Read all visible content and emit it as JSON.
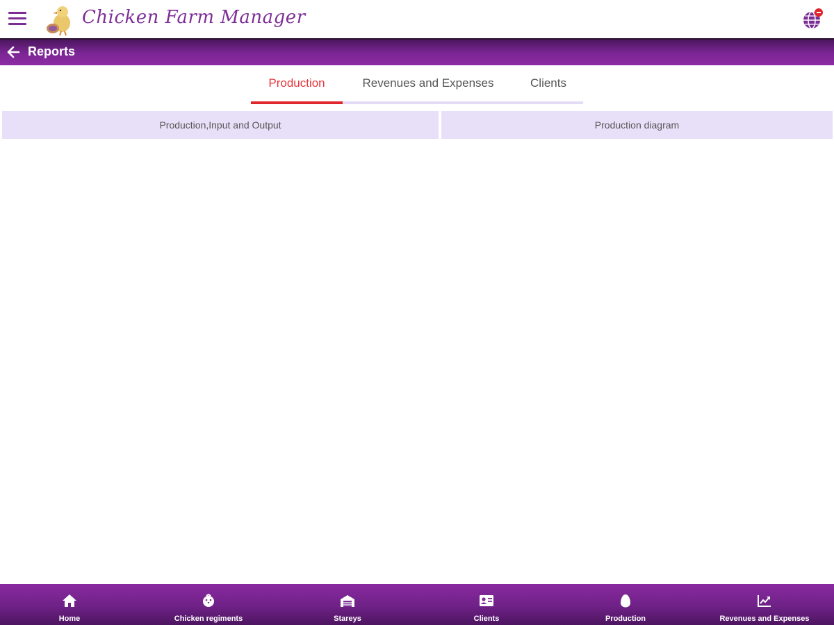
{
  "app": {
    "title": "Chicken Farm Manager"
  },
  "header": {
    "title": "Reports"
  },
  "tabs": [
    {
      "label": "Production",
      "active": true
    },
    {
      "label": "Revenues and Expenses",
      "active": false
    },
    {
      "label": "Clients",
      "active": false
    }
  ],
  "reports": {
    "left_button": "Production,Input and Output",
    "right_button": "Production diagram"
  },
  "bottom_nav": [
    {
      "label": "Home",
      "icon": "home-icon"
    },
    {
      "label": "Chicken regiments",
      "icon": "chick-icon"
    },
    {
      "label": "Stareys",
      "icon": "barn-icon"
    },
    {
      "label": "Clients",
      "icon": "contact-card-icon"
    },
    {
      "label": "Production",
      "icon": "egg-icon"
    },
    {
      "label": "Revenues and Expenses",
      "icon": "trending-up-icon"
    }
  ],
  "colors": {
    "primary": "#7b2d94",
    "accent": "#e0262c",
    "tab_track": "#e4dcf7",
    "button_bg": "#e8e0f9"
  }
}
